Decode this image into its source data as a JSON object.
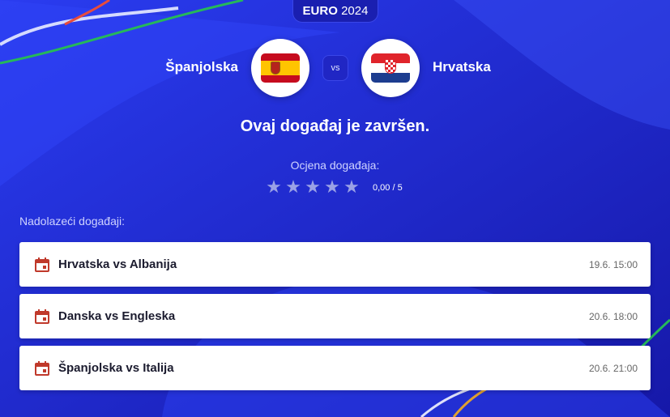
{
  "header": {
    "badge_brand": "EURO",
    "badge_year": "2024"
  },
  "match": {
    "home_team": "Španjolska",
    "away_team": "Hrvatska",
    "vs_label": "vs",
    "home_flag": "spain-flag-icon",
    "away_flag": "croatia-flag-icon",
    "status": "Ovaj događaj je završen."
  },
  "rating": {
    "label": "Ocjena događaja:",
    "value_text": "0,00 / 5",
    "value": 0,
    "max": 5
  },
  "upcoming": {
    "label": "Nadolazeći događaji:",
    "events": [
      {
        "title": "Hrvatska vs Albanija",
        "time": "19.6. 15:00"
      },
      {
        "title": "Danska vs Engleska",
        "time": "20.6. 18:00"
      },
      {
        "title": "Španjolska vs Italija",
        "time": "20.6. 21:00"
      }
    ]
  },
  "colors": {
    "background": "#2430d6",
    "calendar_icon": "#c0392b",
    "star_empty": "#9aa1e6"
  }
}
